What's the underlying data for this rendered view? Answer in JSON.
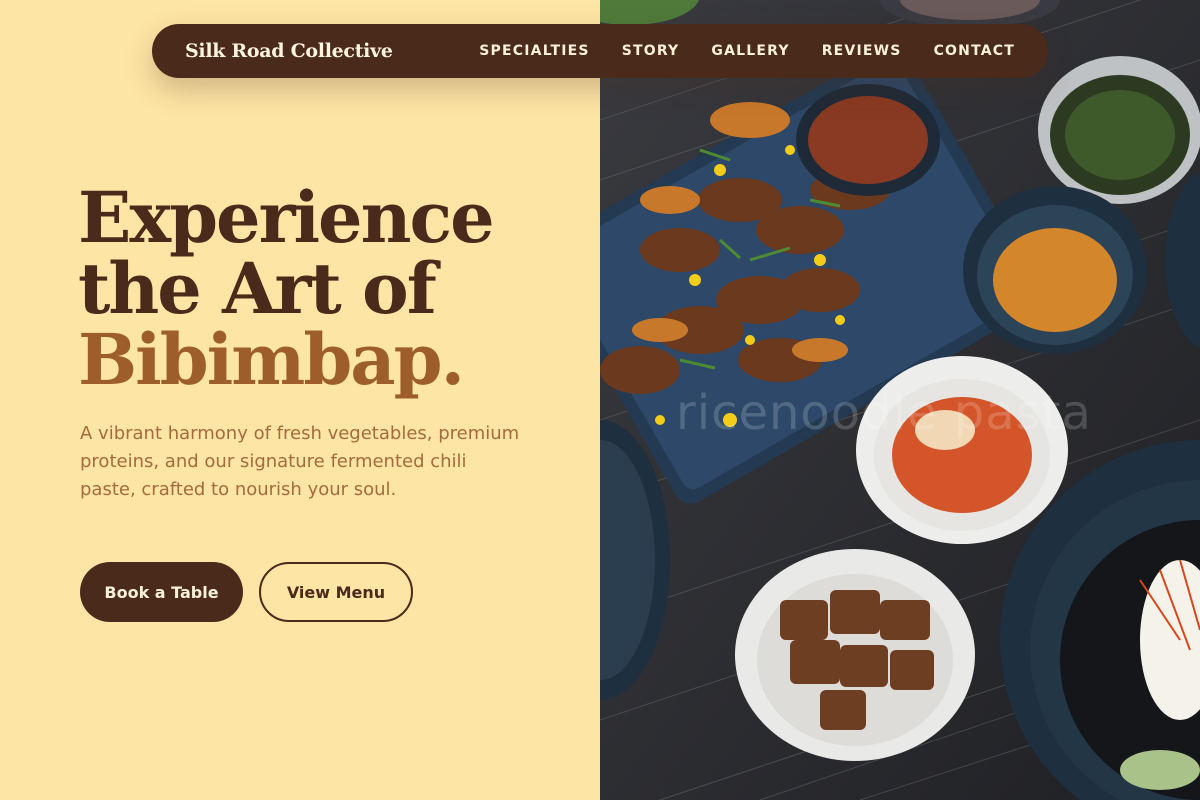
{
  "nav": {
    "brand": "Silk Road Collective",
    "links": [
      "SPECIALTIES",
      "STORY",
      "GALLERY",
      "REVIEWS",
      "CONTACT"
    ]
  },
  "hero": {
    "title_line1": "Experience",
    "title_line2": "the Art of",
    "title_accent": "Bibimbap.",
    "description": "A vibrant harmony of fresh vegetables, premium proteins, and our signature fermented chili paste, crafted to nourish your soul.",
    "primary_button": "Book a Table",
    "secondary_button": "View Menu"
  },
  "image": {
    "watermark": "ricenoodle pasta"
  },
  "colors": {
    "background": "#fde5a5",
    "brand_brown": "#4a2a1a",
    "accent_brown": "#9e5e2c",
    "body_text": "#a66a3c"
  }
}
